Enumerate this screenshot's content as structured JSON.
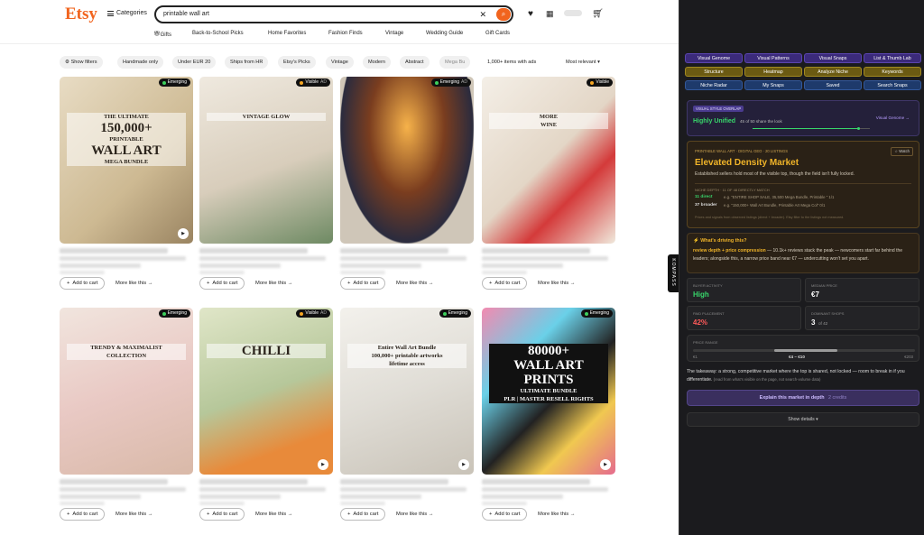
{
  "header": {
    "logo": "Etsy",
    "categories": "Categories",
    "search_value": "printable wall art",
    "clear_glyph": "✕",
    "search_glyph": "⌕",
    "icons": [
      "heart-icon",
      "gift-icon",
      "avatar",
      "cart-icon"
    ]
  },
  "nav": [
    "Gifts",
    "Back-to-School Picks",
    "Home Favorites",
    "Fashion Finds",
    "Vintage",
    "Wedding Guide",
    "Gift Cards"
  ],
  "filters": {
    "show_filters": "Show filters",
    "chips": [
      "Handmade only",
      "Under EUR 20",
      "Ships from HR",
      "Etsy's Picks",
      "Vintage",
      "Modern",
      "Abstract",
      "Mega Bu"
    ],
    "count": "1,000+ items with ads",
    "sort": "Most relevant"
  },
  "listings": [
    {
      "badge": "Emerging",
      "dot": "#3ecf5c",
      "ad": "",
      "title_lines": [
        "THE ULTIMATE",
        "150,000+",
        "PRINTABLE",
        "WALL ART",
        "MEGA BUNDLE"
      ],
      "video": true
    },
    {
      "badge": "Visible",
      "dot": "#f5a623",
      "ad": "AD",
      "title_lines": [
        "VINTAGE GLOW"
      ],
      "video": false
    },
    {
      "badge": "Emerging",
      "dot": "#3ecf5c",
      "ad": "AD",
      "title_lines": [],
      "video": false
    },
    {
      "badge": "Visible",
      "dot": "#f5a623",
      "ad": "",
      "title_lines": [
        "MORE",
        "WINE"
      ],
      "video": false
    },
    {
      "badge": "Emerging",
      "dot": "#3ecf5c",
      "ad": "",
      "title_lines": [
        "TRENDY & MAXIMALIST",
        "COLLECTION"
      ],
      "video": false
    },
    {
      "badge": "Visible",
      "dot": "#f5a623",
      "ad": "AD",
      "title_lines": [
        "CHILLI"
      ],
      "video": true
    },
    {
      "badge": "Emerging",
      "dot": "#3ecf5c",
      "ad": "",
      "title_lines": [
        "Entire Wall Art Bundle",
        "100,000+ printable artworks",
        "lifetime access"
      ],
      "video": true
    },
    {
      "badge": "Emerging",
      "dot": "#3ecf5c",
      "ad": "",
      "title_lines": [
        "80000+",
        "WALL ART",
        "PRINTS",
        "ULTIMATE BUNDLE",
        "PLR | MASTER RESELL RIGHTS"
      ],
      "video": true
    }
  ],
  "card_actions": {
    "add_to_cart": "Add to cart",
    "more_like_this": "More like this →",
    "cart_glyph": "+"
  },
  "side_tab": "KOMPASS",
  "panel": {
    "buttons_row1": [
      "Visual Genome",
      "Visual Patterns",
      "Visual Snaps",
      "List & Thumb Lab"
    ],
    "buttons_row2": [
      "Structure",
      "Heatmap",
      "Analyze Niche",
      "Keywords"
    ],
    "buttons_row3": [
      "Niche Radar",
      "My Snaps",
      "Saved",
      "Search Snaps"
    ],
    "overlay": {
      "tag": "VISUAL STYLE OVERLAP",
      "status": "Highly Unified",
      "detail": "45 of 50 share the look",
      "link": "Visual Genome →",
      "ratio": 0.9
    },
    "market": {
      "eyebrow": "PRINTABLE WALL ART · DIGITAL GEO · 20 LISTINGS",
      "watch": "☆ Watch",
      "title": "Elevated Density Market",
      "desc": "Established sellers hold most of the visible top, though the field isn't fully locked.",
      "depth_label": "NICHE DEPTH · 11 OF 48 DIRECTLY MATCH",
      "row1_k": "11 direct",
      "row1_v": "e.g. \"ENTIRE SHOP SALE, 35,500 Mega Bundle, Printable \" 1/1",
      "row2_k": "37 broader",
      "row2_v": "e.g. \"150,000+ Wall Art Bundle, Printable Art Mega Col\" 0/1",
      "foot": "Prices and signals from observed listings (direct + broader). Etsy filter to the listings not measured."
    },
    "driving": {
      "title": "⚡ What's driving this?",
      "bold": "review depth + price compression",
      "text": " — 10.1k+ reviews stack the peak — newcomers start far behind the leaders; alongside this, a narrow price band near €7 — undercutting won't set you apart."
    },
    "stats": [
      {
        "label": "BUYER ACTIVITY",
        "value": "High",
        "extra": ""
      },
      {
        "label": "MEDIAN PRICE",
        "value": "€7",
        "extra": ""
      },
      {
        "label": "PAID PLACEMENT",
        "value": "42%",
        "extra": ""
      },
      {
        "label": "DOMINANT SHOPS",
        "value": "3",
        "extra": "of 42"
      }
    ],
    "price_range": {
      "label": "PRICE RANGE",
      "min": "€1",
      "band": "€4 – €10",
      "max": "€203"
    },
    "takeaway": "The takeaway: a strong, competitive market where the top is shared, not locked — room to break in if you differentiate.",
    "takeaway_note": " (read from what's visible on the page, not search-volume data)",
    "explain": {
      "label": "Explain this market in depth",
      "credits": "2 credits"
    },
    "details": "Show details ▾"
  },
  "colors": {
    "etsy_orange": "#f1641e",
    "panel_bg": "#1b1b1e",
    "gold_title": "#f0b429",
    "green": "#38d66b",
    "red": "#ff5a5a"
  }
}
